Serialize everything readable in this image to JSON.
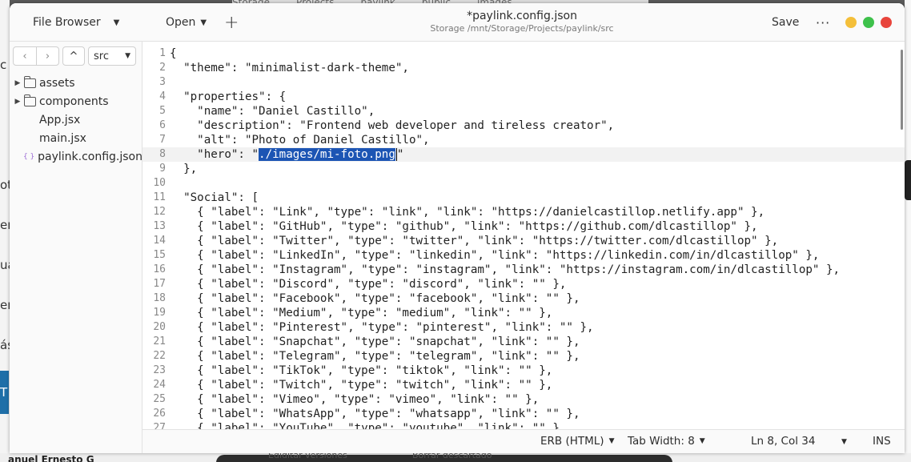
{
  "header": {
    "file_browser_label": "File Browser",
    "open_label": "Open",
    "new_tab_icon": "+",
    "title": "*paylink.config.json",
    "subtitle": "Storage /mnt/Storage/Projects/paylink/src",
    "save_label": "Save",
    "menu_icon": "···"
  },
  "sidebar": {
    "back_icon": "‹",
    "forward_icon": "›",
    "up_icon": "^",
    "current_folder": "src",
    "items": [
      {
        "label": "assets",
        "kind": "folder"
      },
      {
        "label": "components",
        "kind": "folder"
      },
      {
        "label": "App.jsx",
        "kind": "file"
      },
      {
        "label": "main.jsx",
        "kind": "file"
      },
      {
        "label": "paylink.config.json",
        "kind": "json"
      }
    ]
  },
  "editor": {
    "current_line": 8,
    "selected_text": "./images/mi-foto.png",
    "lines": [
      "{",
      "  \"theme\": \"minimalist-dark-theme\",",
      "",
      "  \"properties\": {",
      "    \"name\": \"Daniel Castillo\",",
      "    \"description\": \"Frontend web developer and tireless creator\",",
      "    \"alt\": \"Photo of Daniel Castillo\",",
      "    \"hero\": \"./images/mi-foto.png\"",
      "  },",
      "",
      "  \"Social\": [",
      "    { \"label\": \"Link\", \"type\": \"link\", \"link\": \"https://danielcastillop.netlify.app\" },",
      "    { \"label\": \"GitHub\", \"type\": \"github\", \"link\": \"https://github.com/dlcastillop\" },",
      "    { \"label\": \"Twitter\", \"type\": \"twitter\", \"link\": \"https://twitter.com/dlcastillop\" },",
      "    { \"label\": \"LinkedIn\", \"type\": \"linkedin\", \"link\": \"https://linkedin.com/in/dlcastillop\" },",
      "    { \"label\": \"Instagram\", \"type\": \"instagram\", \"link\": \"https://instagram.com/in/dlcastillop\" },",
      "    { \"label\": \"Discord\", \"type\": \"discord\", \"link\": \"\" },",
      "    { \"label\": \"Facebook\", \"type\": \"facebook\", \"link\": \"\" },",
      "    { \"label\": \"Medium\", \"type\": \"medium\", \"link\": \"\" },",
      "    { \"label\": \"Pinterest\", \"type\": \"pinterest\", \"link\": \"\" },",
      "    { \"label\": \"Snapchat\", \"type\": \"snapchat\", \"link\": \"\" },",
      "    { \"label\": \"Telegram\", \"type\": \"telegram\", \"link\": \"\" },",
      "    { \"label\": \"TikTok\", \"type\": \"tiktok\", \"link\": \"\" },",
      "    { \"label\": \"Twitch\", \"type\": \"twitch\", \"link\": \"\" },",
      "    { \"label\": \"Vimeo\", \"type\": \"vimeo\", \"link\": \"\" },",
      "    { \"label\": \"WhatsApp\", \"type\": \"whatsapp\", \"link\": \"\" },",
      "    { \"label\": \"YouTube\", \"type\": \"youtube\", \"link\": \"\" }"
    ]
  },
  "statusbar": {
    "language": "ERB (HTML)",
    "tab_width": "Tab Width: 8",
    "position": "Ln 8, Col 34",
    "mode": "INS"
  },
  "background": {
    "top_crumbs": [
      "Storage",
      "Projects",
      "paylink",
      "public",
      "images"
    ],
    "left_fragments": [
      "c",
      "ot",
      "er",
      "ua",
      "er",
      "ás",
      "T"
    ],
    "bottom_name": "anuel Ernesto G",
    "bottom_left_text": "Ediditar versiones",
    "bottom_right_text": "Borrar descartado"
  },
  "colors": {
    "selection": "#1c55b4",
    "current_line": "#f2f2f2",
    "minimize": "#f4bf3a",
    "maximize": "#3ec14b",
    "close": "#e8453c"
  }
}
